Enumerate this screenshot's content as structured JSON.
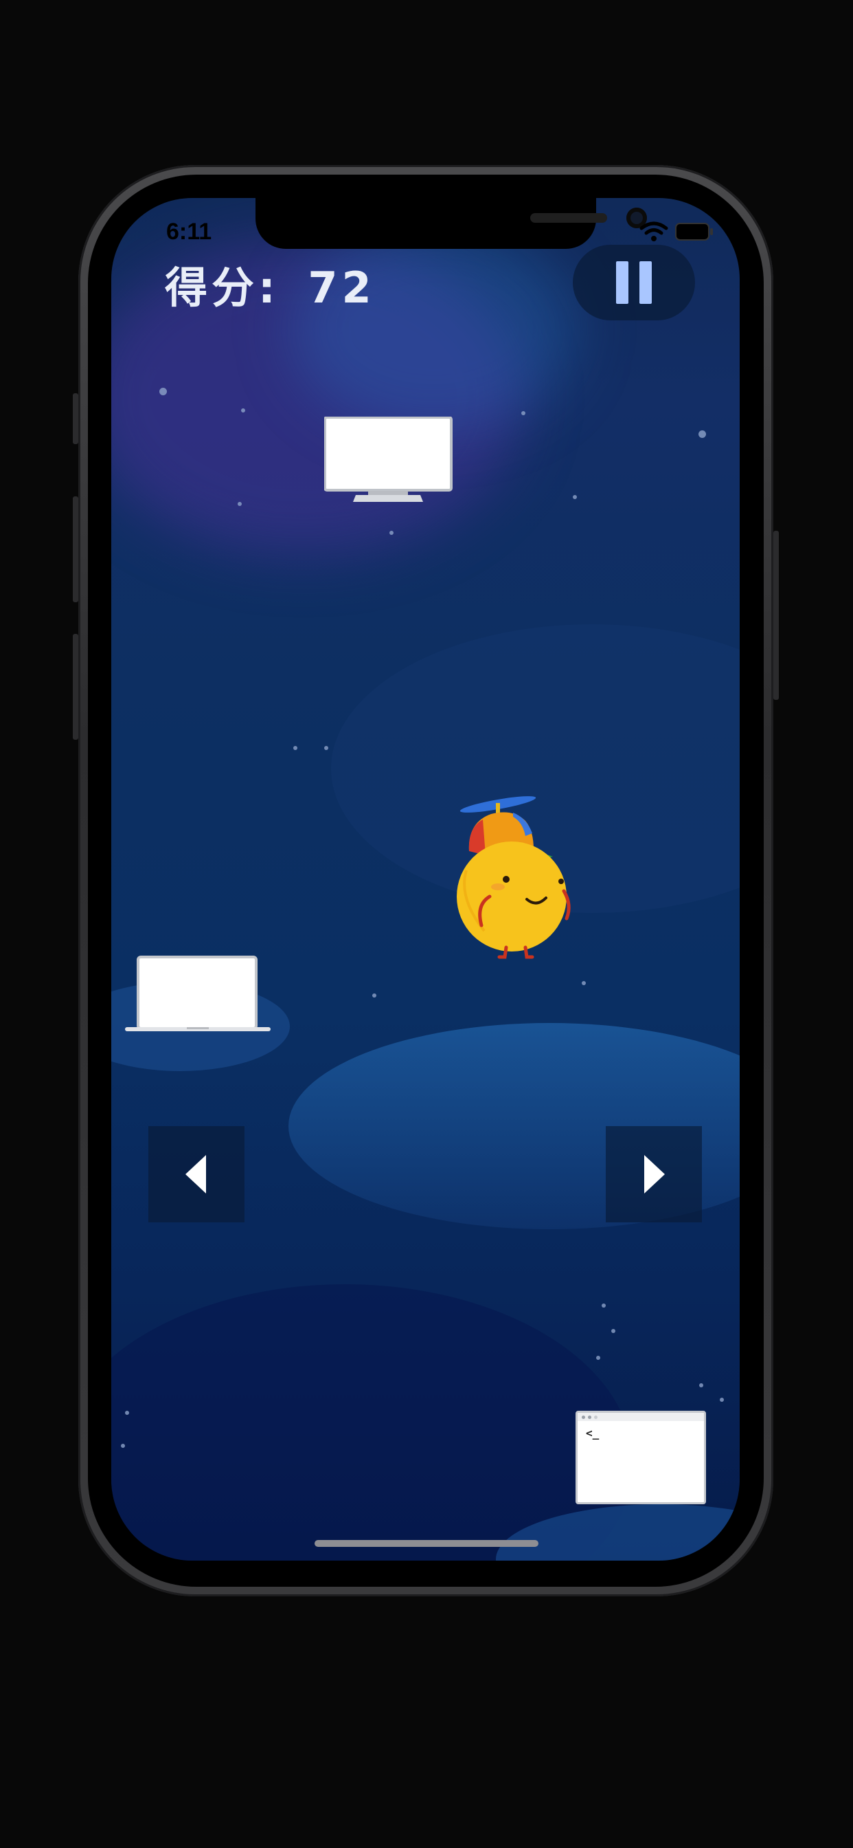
{
  "status_bar": {
    "time": "6:11"
  },
  "hud": {
    "score_label": "得分:",
    "score_value": "72"
  },
  "terminal": {
    "prompt": "<_"
  },
  "icons": {
    "pause": "pause-icon",
    "left": "arrow-left-icon",
    "right": "arrow-right-icon",
    "player": "propeller-cap-chick-character",
    "platforms": [
      "desktop-monitor-platform",
      "laptop-platform",
      "terminal-window-platform"
    ]
  },
  "colors": {
    "background_top": "#102a5a",
    "background_bottom": "#061b4a",
    "score_text": "#e9eef8",
    "pause_bar": "#a9c6ff",
    "player_body": "#f7c31c"
  }
}
